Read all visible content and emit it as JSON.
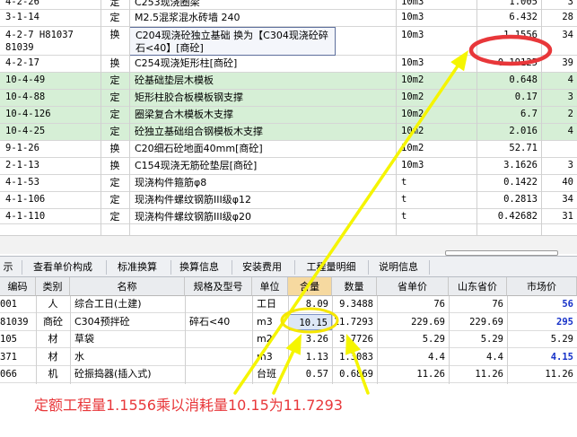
{
  "upper_rows": [
    {
      "code": "4-2-26",
      "type": "定",
      "name": "C253现浇圈梁",
      "unit": "10m3",
      "qty": "1.005",
      "extra": "3",
      "highlight": false,
      "selected": false
    },
    {
      "code": "3-1-14",
      "type": "定",
      "name": "M2.5混浆混水砖墙 240",
      "unit": "10m3",
      "qty": "6.432",
      "extra": "28",
      "highlight": false,
      "selected": false
    },
    {
      "code": "4-2-7 H81037 81039",
      "type": "换",
      "name": "C204现浇砼独立基础  换为【C304现浇砼碎石<40】[商砼]",
      "unit": "10m3",
      "qty": "1.1556",
      "extra": "34",
      "highlight": false,
      "selected": true
    },
    {
      "code": "4-2-17",
      "type": "换",
      "name": "C254现浇矩形柱[商砼]",
      "unit": "10m3",
      "qty": "0.19125",
      "extra": "39",
      "highlight": false,
      "selected": false
    },
    {
      "code": "10-4-49",
      "type": "定",
      "name": "砼基础垫层木模板",
      "unit": "10m2",
      "qty": "0.648",
      "extra": "4",
      "highlight": true,
      "selected": false
    },
    {
      "code": "10-4-88",
      "type": "定",
      "name": "矩形柱胶合板模板钢支撑",
      "unit": "10m2",
      "qty": "0.17",
      "extra": "3",
      "highlight": true,
      "selected": false
    },
    {
      "code": "10-4-126",
      "type": "定",
      "name": "圈梁复合木模板木支撑",
      "unit": "10m2",
      "qty": "6.7",
      "extra": "2",
      "highlight": true,
      "selected": false
    },
    {
      "code": "10-4-25",
      "type": "定",
      "name": "砼独立基础组合钢模板木支撑",
      "unit": "10m2",
      "qty": "2.016",
      "extra": "4",
      "highlight": true,
      "selected": false
    },
    {
      "code": "9-1-26",
      "type": "换",
      "name": "C20细石砼地面40mm[商砼]",
      "unit": "10m2",
      "qty": "52.71",
      "extra": "",
      "highlight": false,
      "selected": false
    },
    {
      "code": "2-1-13",
      "type": "换",
      "name": "C154现浇无筋砼垫层[商砼]",
      "unit": "10m3",
      "qty": "3.1626",
      "extra": "3",
      "highlight": false,
      "selected": false
    },
    {
      "code": "4-1-53",
      "type": "定",
      "name": "现浇构件箍筋φ8",
      "unit": "t",
      "qty": "0.1422",
      "extra": "40",
      "highlight": false,
      "selected": false
    },
    {
      "code": "4-1-106",
      "type": "定",
      "name": "现浇构件螺纹钢筋III级φ12",
      "unit": "t",
      "qty": "0.2813",
      "extra": "34",
      "highlight": false,
      "selected": false
    },
    {
      "code": "4-1-110",
      "type": "定",
      "name": "现浇构件螺纹钢筋III级φ20",
      "unit": "t",
      "qty": "0.42682",
      "extra": "31",
      "highlight": false,
      "selected": false
    }
  ],
  "tabs": [
    "示",
    "查看单价构成",
    "标准换算",
    "换算信息",
    "安装费用",
    "工程量明细",
    "说明信息"
  ],
  "bottom_headers": [
    "编码",
    "类别",
    "名称",
    "规格及型号",
    "单位",
    "含量",
    "数量",
    "省单价",
    "山东省价",
    "市场价"
  ],
  "bottom_rows": [
    {
      "code": "001",
      "type": "人",
      "name": "综合工日(土建)",
      "spec": "",
      "unit": "工日",
      "content": "8.09",
      "amount": "9.3488",
      "prov_price": "76",
      "sd_price": "76",
      "market": "56",
      "market_blue": true
    },
    {
      "code": "81039",
      "type": "商砼",
      "name": "C304预拌砼",
      "spec": "碎石<40",
      "unit": "m3",
      "content": "10.15",
      "amount": "11.7293",
      "prov_price": "229.69",
      "sd_price": "229.69",
      "market": "295",
      "market_blue": true
    },
    {
      "code": "105",
      "type": "材",
      "name": "草袋",
      "spec": "",
      "unit": "m2",
      "content": "3.26",
      "amount": "3.7726",
      "prov_price": "5.29",
      "sd_price": "5.29",
      "market": "5.29",
      "market_blue": false
    },
    {
      "code": "371",
      "type": "材",
      "name": "水",
      "spec": "",
      "unit": "m3",
      "content": "1.13",
      "amount": "1.3083",
      "prov_price": "4.4",
      "sd_price": "4.4",
      "market": "4.15",
      "market_blue": true
    },
    {
      "code": "066",
      "type": "机",
      "name": "砼振捣器(插入式)",
      "spec": "",
      "unit": "台班",
      "content": "0.57",
      "amount": "0.6869",
      "prov_price": "11.26",
      "sd_price": "11.26",
      "market": "11.26",
      "market_blue": false
    }
  ],
  "annotation": {
    "caption": "定额工程量1.1556乘以消耗量10.15为11.7293",
    "color": "#e8373a",
    "arrow_color": "#f5f500"
  },
  "colors": {
    "row_green": "#d6efd6",
    "selected_border": "#5d6f9c",
    "header_blue_highlight": "#f6d9a0",
    "market_blue": "#1530c8"
  }
}
